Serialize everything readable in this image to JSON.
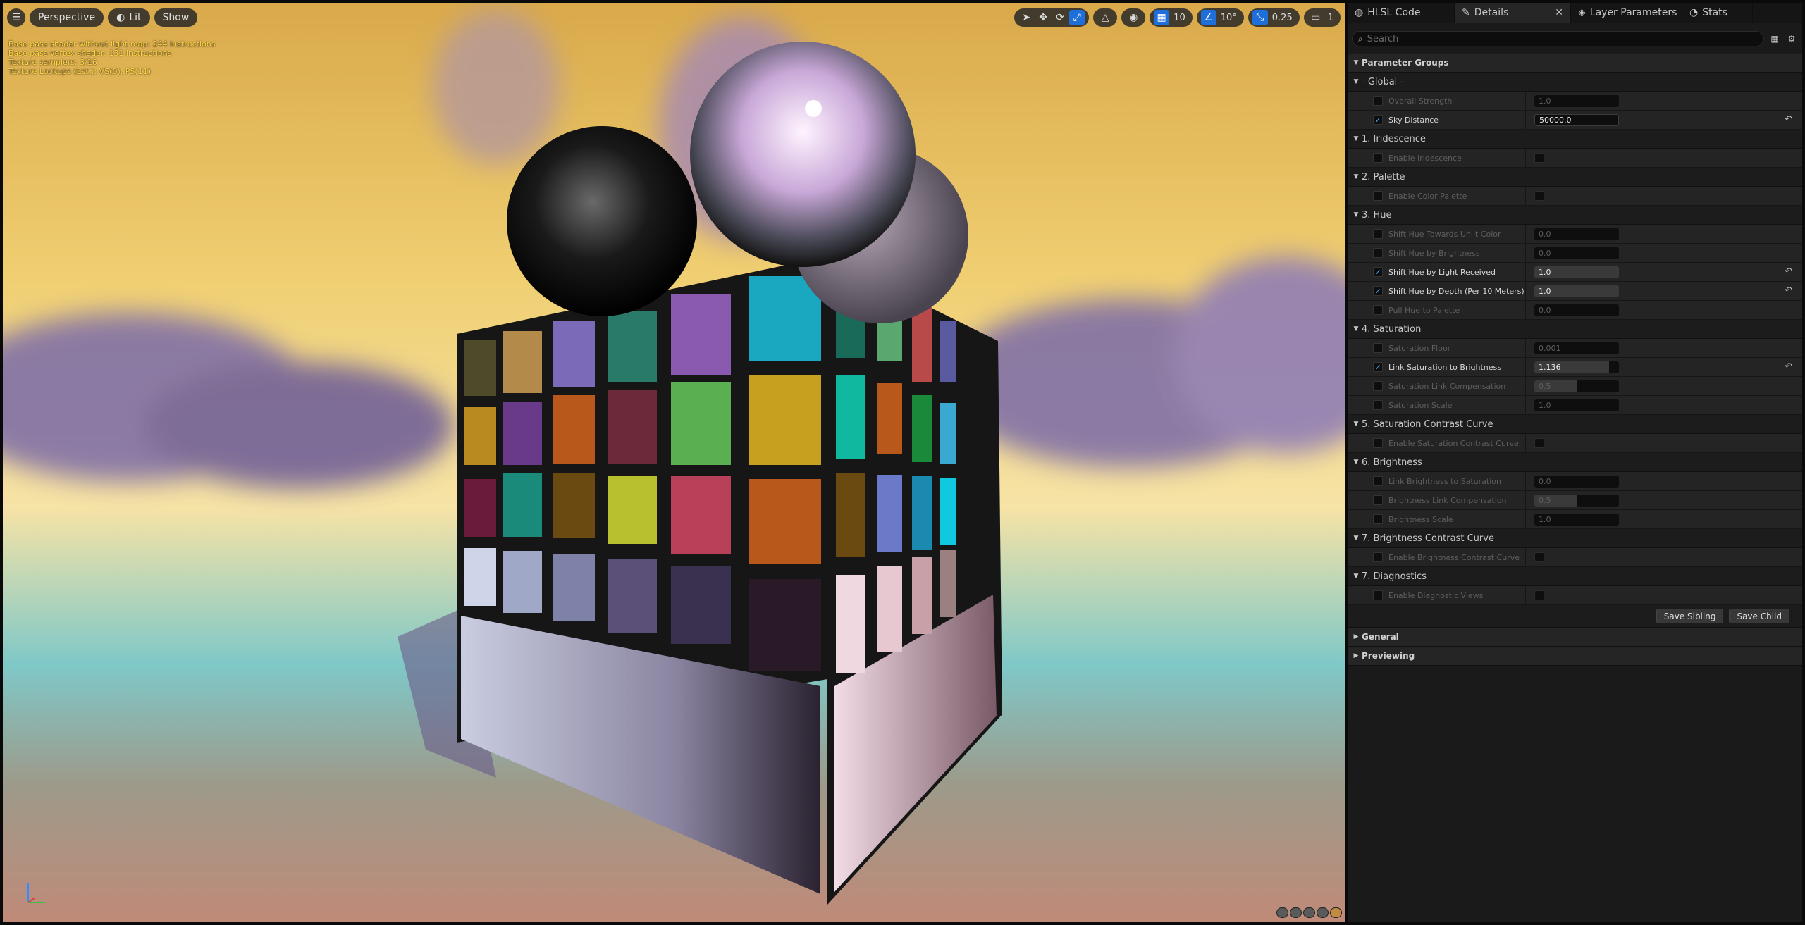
{
  "viewport": {
    "toolbar_left": {
      "menu_icon": "hamburger-icon",
      "view_mode": "Perspective",
      "lighting": "Lit",
      "show": "Show"
    },
    "toolbar_right": {
      "grid_snap": "10",
      "rotation_snap": "10°",
      "scale_snap": "0.25",
      "camera_speed": "1"
    },
    "stats": [
      "Base pass shader without light map: 244 instructions",
      "Base pass vertex shader: 131 instructions",
      "Texture samplers: 3/16",
      "Texture Lookups (Est.): VS(0), PS(11)"
    ]
  },
  "tabs": [
    {
      "label": "HLSL Code",
      "icon": "hlsl-icon"
    },
    {
      "label": "Details",
      "icon": "pencil-icon",
      "active": true
    },
    {
      "label": "Layer Parameters",
      "icon": "layers-icon"
    },
    {
      "label": "Stats",
      "icon": "stats-icon"
    }
  ],
  "search": {
    "placeholder": "Search"
  },
  "parameter_groups_label": "Parameter Groups",
  "groups": [
    {
      "title": "- Global -",
      "params": [
        {
          "name": "Overall Strength",
          "type": "number",
          "value": "1.0",
          "enabled": false
        },
        {
          "name": "Sky Distance",
          "type": "text",
          "value": "50000.0",
          "enabled": true,
          "reset": true
        }
      ]
    },
    {
      "title": "1. Iridescence",
      "params": [
        {
          "name": "Enable Iridescence",
          "type": "bool",
          "enabled": false
        }
      ]
    },
    {
      "title": "2. Palette",
      "params": [
        {
          "name": "Enable Color Palette",
          "type": "bool",
          "enabled": false
        }
      ]
    },
    {
      "title": "3. Hue",
      "params": [
        {
          "name": "Shift Hue Towards Unlit Color",
          "type": "number",
          "value": "0.0",
          "enabled": false
        },
        {
          "name": "Shift Hue by Brightness",
          "type": "slider",
          "value": "0.0",
          "fill": 0.0,
          "enabled": false
        },
        {
          "name": "Shift Hue by Light Received",
          "type": "slider",
          "value": "1.0",
          "fill": 1.0,
          "enabled": true,
          "reset": true
        },
        {
          "name": "Shift Hue by Depth (Per 10 Meters)",
          "type": "slider",
          "value": "1.0",
          "fill": 1.0,
          "enabled": true,
          "reset": true
        },
        {
          "name": "Pull Hue to Palette",
          "type": "slider",
          "value": "0.0",
          "fill": 0.0,
          "enabled": false
        }
      ]
    },
    {
      "title": "4. Saturation",
      "params": [
        {
          "name": "Saturation Floor",
          "type": "number",
          "value": "0.001",
          "enabled": false
        },
        {
          "name": "Link Saturation to Brightness",
          "type": "slider",
          "value": "1.136",
          "fill": 0.88,
          "enabled": true,
          "reset": true
        },
        {
          "name": "Saturation Link Compensation",
          "type": "slider",
          "value": "0.5",
          "fill": 0.5,
          "enabled": false
        },
        {
          "name": "Saturation Scale",
          "type": "number",
          "value": "1.0",
          "enabled": false
        }
      ]
    },
    {
      "title": "5. Saturation Contrast Curve",
      "params": [
        {
          "name": "Enable Saturation Contrast Curve",
          "type": "bool",
          "enabled": false
        }
      ]
    },
    {
      "title": "6. Brightness",
      "params": [
        {
          "name": "Link Brightness to Saturation",
          "type": "slider",
          "value": "0.0",
          "fill": 0.0,
          "enabled": false
        },
        {
          "name": "Brightness Link Compensation",
          "type": "slider",
          "value": "0.5",
          "fill": 0.5,
          "enabled": false
        },
        {
          "name": "Brightness Scale",
          "type": "number",
          "value": "1.0",
          "enabled": false
        }
      ]
    },
    {
      "title": "7. Brightness Contrast Curve",
      "params": [
        {
          "name": "Enable Brightness Contrast Curve",
          "type": "bool",
          "enabled": false
        }
      ]
    },
    {
      "title": "7. Diagnostics",
      "params": [
        {
          "name": "Enable Diagnostic Views",
          "type": "bool",
          "enabled": false
        }
      ]
    }
  ],
  "buttons": {
    "save_sibling": "Save Sibling",
    "save_child": "Save Child"
  },
  "collapsed_categories": [
    "General",
    "Previewing"
  ],
  "colors": {
    "accent": "#1e6fd9",
    "check": "#4aa8ff",
    "panel_bg": "#1a1a1a",
    "stats_text": "#ffd640"
  }
}
